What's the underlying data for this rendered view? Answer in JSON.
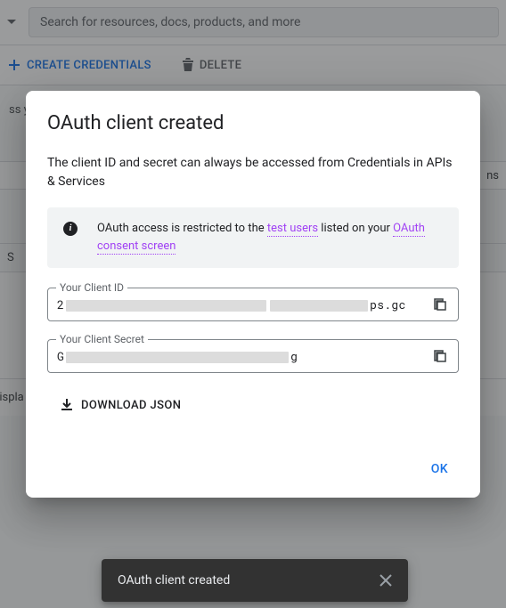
{
  "search": {
    "placeholder": "Search for resources, docs, products, and more"
  },
  "toolbar": {
    "create_label": "CREATE CREDENTIALS",
    "delete_label": "DELETE"
  },
  "bg": {
    "text1": "ss you",
    "text2": "ns",
    "text3": "S",
    "text4": "displa"
  },
  "dialog": {
    "title": "OAuth client created",
    "lead": "The client ID and secret can always be accessed from Credentials in APIs & Services",
    "info_prefix": "OAuth access is restricted to the ",
    "info_link1": "test users",
    "info_mid": " listed on your ",
    "info_link2": "OAuth consent screen",
    "client_id_label": "Your Client ID",
    "client_id_prefix": "2",
    "client_id_suffix": "ps.gc",
    "client_secret_label": "Your Client Secret",
    "client_secret_prefix": "G",
    "client_secret_suffix": "g",
    "download_label": "DOWNLOAD JSON",
    "ok_label": "OK"
  },
  "toast": {
    "message": "OAuth client created"
  }
}
